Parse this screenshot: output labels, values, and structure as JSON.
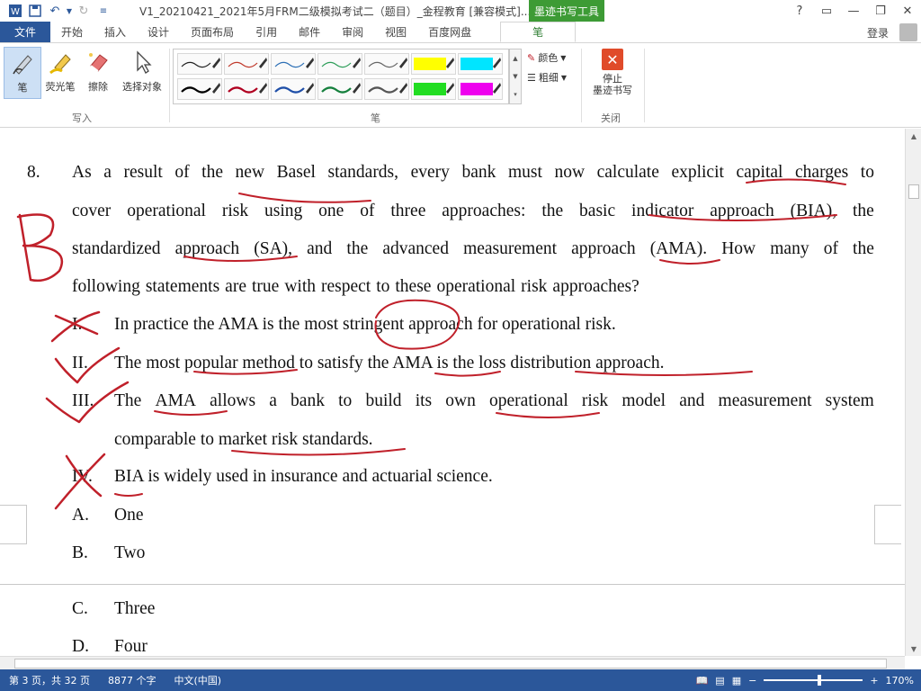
{
  "titlebar": {
    "doc_title": "V1_20210421_2021年5月FRM二级模拟考试二（题目）_金程教育 [兼容模式]...",
    "context_tab": "墨迹书写工具",
    "help": "?",
    "icons": {
      "word": "word-icon",
      "save": "save-icon",
      "undo": "undo-icon",
      "redo": "redo-icon"
    }
  },
  "tabs": {
    "file": "文件",
    "items": [
      "开始",
      "插入",
      "设计",
      "页面布局",
      "引用",
      "邮件",
      "审阅",
      "视图",
      "百度网盘"
    ],
    "active": "笔",
    "login": "登录"
  },
  "ribbon": {
    "write_group": {
      "label": "写入",
      "tools": [
        {
          "label": "笔",
          "icon": "pen-icon"
        },
        {
          "label": "荧光笔",
          "icon": "highlighter-icon"
        },
        {
          "label": "擦除",
          "icon": "eraser-icon"
        },
        {
          "label": "选择对象",
          "icon": "select-object-icon"
        }
      ]
    },
    "pen_group": {
      "label": "笔",
      "color_label": "颜色",
      "weight_label": "粗细",
      "swatch_colors_top": [
        "#222222",
        "#c0392b",
        "#2c6fb5",
        "#2e9e5a",
        "#666666",
        "#ffff00",
        "#00e5ff"
      ],
      "swatch_colors_bottom": [
        "#000000",
        "#b00020",
        "#1f4fa8",
        "#15803d",
        "#555555",
        "#22dd22",
        "#ee00ee"
      ]
    },
    "close_group": {
      "label": "关闭",
      "stop_label_1": "停止",
      "stop_label_2": "墨迹书写"
    }
  },
  "document": {
    "question_number": "8.",
    "question_lines": [
      [
        "As",
        "a",
        "result",
        "of",
        "the",
        "new",
        "Basel",
        "standards,",
        "every",
        "bank",
        "must",
        "now",
        "calculate",
        "explicit",
        "capital",
        "charges",
        "to"
      ],
      [
        "cover",
        "operational",
        "risk",
        "using",
        "one",
        "of",
        "three",
        "approaches:",
        "the",
        "basic",
        "indicator",
        "approach",
        "(BIA),",
        "the"
      ],
      [
        "standardized",
        "approach",
        "(SA),",
        "and",
        "the",
        "advanced",
        "measurement",
        "approach",
        "(AMA).",
        "How",
        "many",
        "of",
        "the"
      ],
      [
        "following",
        "statements",
        "are",
        "true",
        "with",
        "respect",
        "to",
        "these",
        "operational",
        "risk",
        "approaches?"
      ]
    ],
    "statements": [
      {
        "num": "I.",
        "text": "In practice the AMA is the most stringent approach for operational risk."
      },
      {
        "num": "II.",
        "text": "The most popular method to satisfy the AMA is the loss distribution approach."
      },
      {
        "num": "III.",
        "text_line1": [
          "The",
          "AMA",
          "allows",
          "a",
          "bank",
          "to",
          "build",
          "its",
          "own",
          "operational",
          "risk",
          "model",
          "and",
          "measurement",
          "system"
        ],
        "text_line2": "comparable to market risk standards."
      },
      {
        "num": "IV.",
        "text": "BIA is widely used in insurance and actuarial science."
      }
    ],
    "options": [
      {
        "letter": "A.",
        "text": "One"
      },
      {
        "letter": "B.",
        "text": "Two"
      },
      {
        "letter": "C.",
        "text": "Three"
      },
      {
        "letter": "D.",
        "text": "Four"
      }
    ],
    "ink_color": "#c0202a",
    "handwritten_answer": "B"
  },
  "statusbar": {
    "page": "第 3 页，共 32 页",
    "words": "8877 个字",
    "language": "中文(中国)",
    "zoom_minus": "−",
    "zoom_plus": "+",
    "zoom": "170%"
  }
}
